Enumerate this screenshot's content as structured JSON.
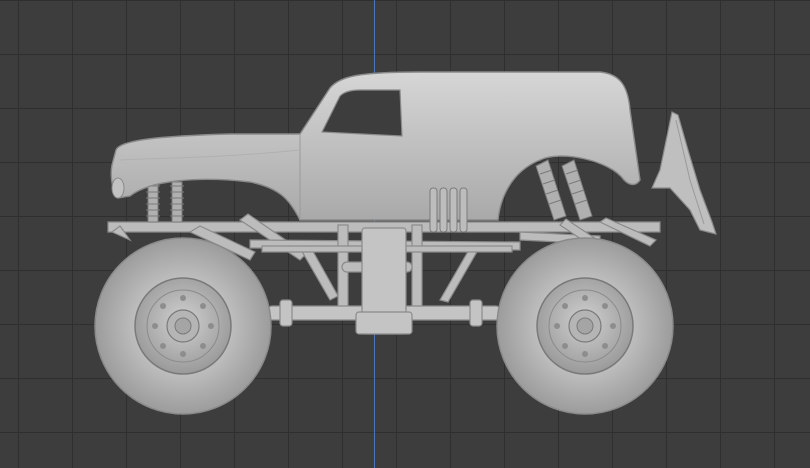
{
  "viewport": {
    "background": "#3d3d3d",
    "grid_color": "#2f2f2f",
    "axis_color": "#4a77b8",
    "model": {
      "icon": "monster-truck-model",
      "body_color": "#c7c7c7",
      "shadow_color": "#8e8e8e",
      "tire_color": "#bdbdbd"
    }
  }
}
